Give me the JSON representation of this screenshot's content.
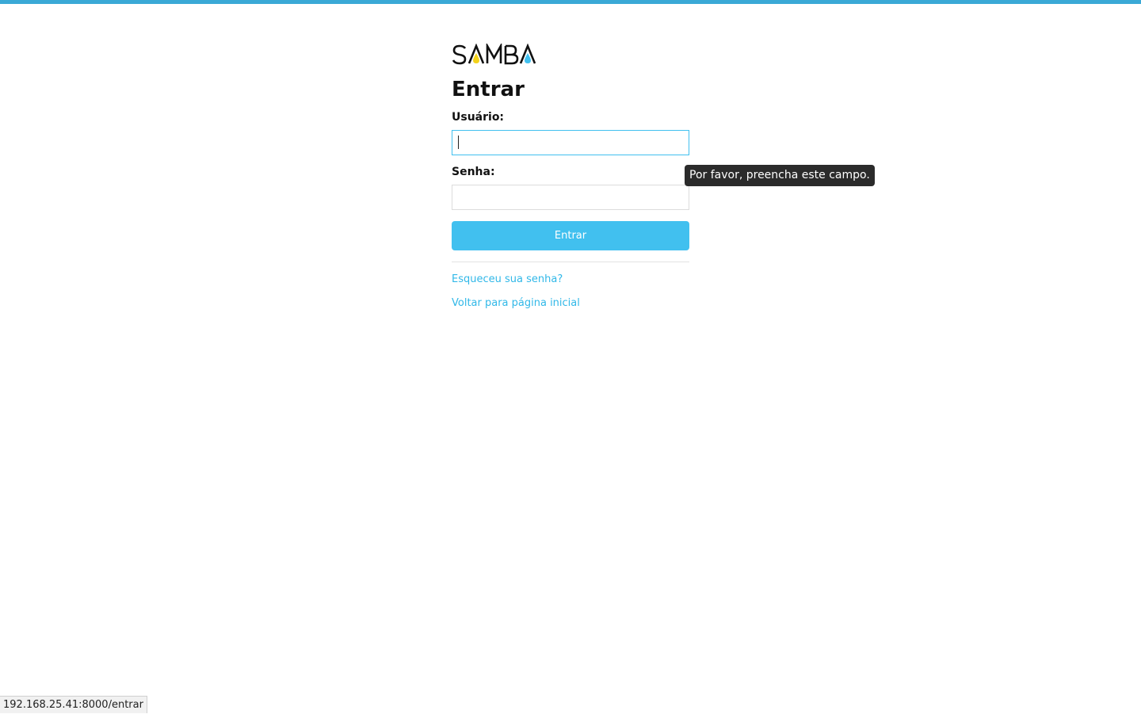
{
  "brand": {
    "name": "SAMBA",
    "accent_color": "#41c0ef",
    "accent_yellow": "#f3d21b"
  },
  "page": {
    "title": "Entrar"
  },
  "form": {
    "username_label": "Usuário:",
    "username_value": "",
    "password_label": "Senha:",
    "password_value": "",
    "submit_label": "Entrar"
  },
  "links": {
    "forgot_password": "Esqueceu sua senha?",
    "back_home": "Voltar para página inicial"
  },
  "tooltip": {
    "text": "Por favor, preencha este campo."
  },
  "status_bar": {
    "url": "192.168.25.41:8000/entrar"
  }
}
